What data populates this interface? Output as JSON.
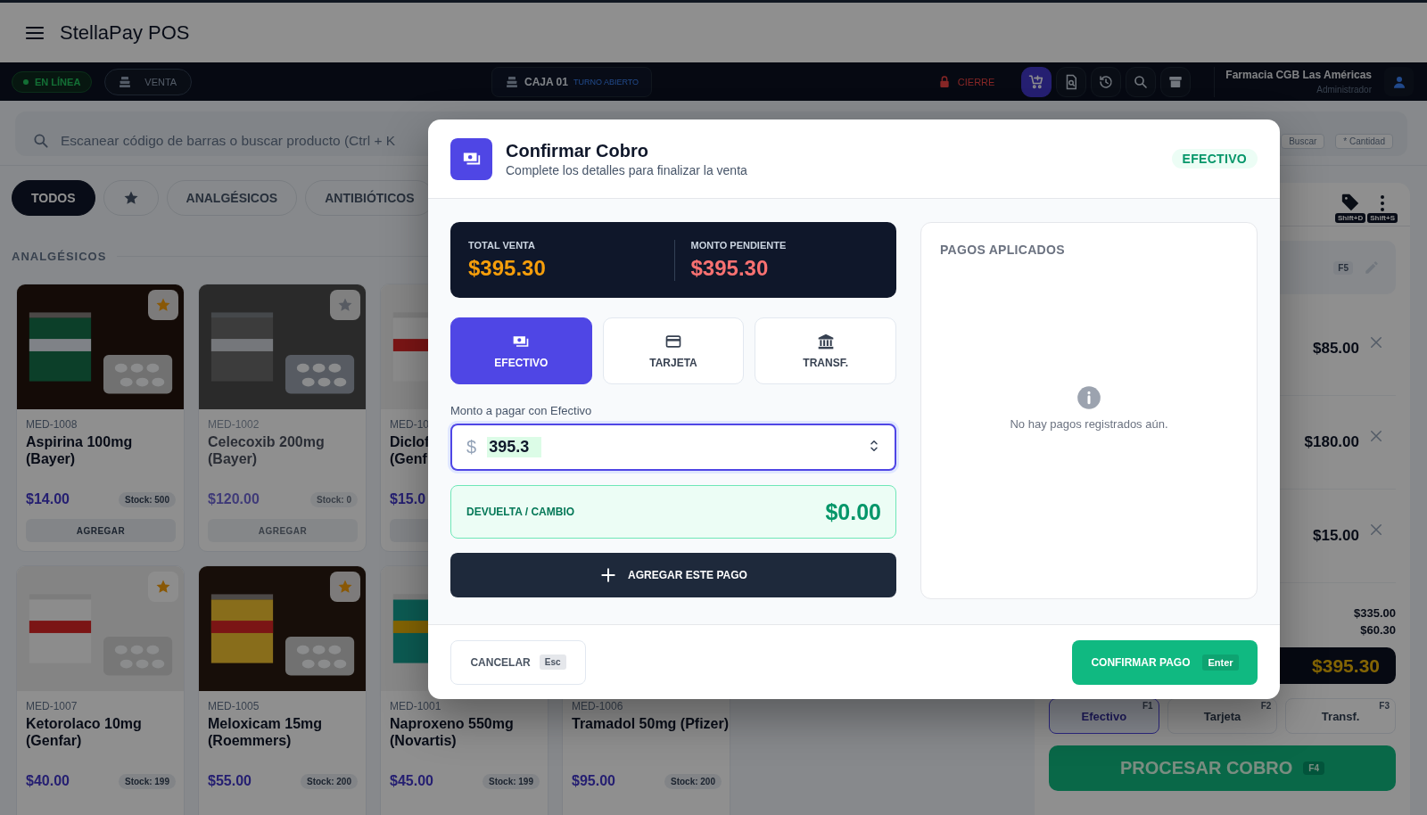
{
  "app": {
    "title": "StellaPay POS"
  },
  "nav": {
    "status": {
      "label": "EN LÍNEA",
      "online": true
    },
    "mode": {
      "label": "VENTA"
    },
    "register": {
      "name": "CAJA 01",
      "shift": "TURNO ABIERTO"
    },
    "close": {
      "label": "CIERRE"
    },
    "tools": [
      {
        "kind": "cart",
        "selected": true
      },
      {
        "kind": "preview",
        "selected": false
      },
      {
        "kind": "history",
        "selected": false
      },
      {
        "kind": "search",
        "selected": false
      },
      {
        "kind": "archive",
        "selected": false
      }
    ],
    "user": {
      "store": "Farmacia CGB Las Américas",
      "role": "Administrador"
    }
  },
  "search": {
    "placeholder": "Escanear código de barras o buscar producto (Ctrl + K",
    "hints": [
      "Buscar",
      "* Cantidad"
    ]
  },
  "categories": [
    {
      "kind": "text",
      "label": "TODOS",
      "selected": true
    },
    {
      "kind": "favorites",
      "selected": false
    },
    {
      "kind": "text",
      "label": "ANALGÉSICOS",
      "selected": false
    },
    {
      "kind": "text",
      "label": "ANTIBIÓTICOS",
      "selected": false
    }
  ],
  "section": {
    "title": "ANALGÉSICOS"
  },
  "product_rows": [
    [
      {
        "code": "MED-1008",
        "name_lines": [
          "Aspirina 100mg",
          "(Bayer)"
        ],
        "price": "$14.00",
        "stock": "Stock: 500",
        "button": "AGREGAR",
        "favorite": true,
        "disabled": false,
        "photo": true
      },
      {
        "code": "MED-1002",
        "name_lines": [
          "Celecoxib 200mg",
          "(Bayer)"
        ],
        "price": "$120.00",
        "stock": "Stock: 0",
        "button": "AGREGAR",
        "favorite": false,
        "disabled": true,
        "photo": true
      },
      {
        "code": "MED-10",
        "name_lines": [
          "Diclof",
          "(Genf"
        ],
        "price": "$15.0",
        "disabled": false,
        "photo": true
      }
    ],
    [
      {
        "code": "MED-1007",
        "name_lines": [
          "Ketorolaco 10mg",
          "(Genfar)"
        ],
        "price": "$40.00",
        "stock": "Stock: 199",
        "favorite": true,
        "disabled": false,
        "photo": true
      },
      {
        "code": "MED-1005",
        "name_lines": [
          "Meloxicam 15mg",
          "(Roemmers)"
        ],
        "price": "$55.00",
        "stock": "Stock: 200",
        "favorite": true,
        "disabled": false,
        "photo": true
      },
      {
        "code": "MED-1001",
        "name_lines": [
          "Naproxeno 550mg",
          "(Novartis)"
        ],
        "price": "$45.00",
        "stock": "Stock: 199",
        "disabled": false,
        "photo": true
      },
      {
        "code": "MED-1006",
        "name_lines": [
          "Tramadol 50mg (Pfizer)"
        ],
        "price": "$95.00",
        "stock": "Stock: 200",
        "disabled": false
      }
    ]
  ],
  "cart": {
    "actions": [
      {
        "kind": "tag",
        "shortcut": "Shift+D"
      },
      {
        "kind": "more",
        "shortcut": "Shift+S"
      }
    ],
    "customer": {
      "shortcut": "F5"
    },
    "items": [
      {
        "total": "$85.00"
      },
      {
        "total": "$180.00"
      },
      {
        "total": "$15.00"
      }
    ],
    "summary": [
      "$335.00",
      "$60.30"
    ],
    "total": "$395.30",
    "methods": [
      {
        "label": "Efectivo",
        "shortcut": "F1",
        "selected": true
      },
      {
        "label": "Tarjeta",
        "shortcut": "F2",
        "selected": false
      },
      {
        "label": "Transf.",
        "shortcut": "F3",
        "selected": false
      }
    ],
    "process": {
      "label": "PROCESAR COBRO",
      "shortcut": "F4"
    }
  },
  "modal": {
    "title": "Confirmar Cobro",
    "subtitle": "Complete los detalles para finalizar la venta",
    "badge": "EFECTIVO",
    "summary": [
      {
        "kind": "total",
        "label": "TOTAL VENTA",
        "amount": "$395.30"
      },
      {
        "kind": "pending",
        "label": "MONTO PENDIENTE",
        "amount": "$395.30"
      }
    ],
    "methods": [
      {
        "kind": "cash",
        "label": "EFECTIVO",
        "selected": true
      },
      {
        "kind": "card",
        "label": "TARJETA",
        "selected": false
      },
      {
        "kind": "bank",
        "label": "TRANSF.",
        "selected": false
      }
    ],
    "amount": {
      "label": "Monto a pagar con Efectivo",
      "prefix": "$",
      "value": "395.3"
    },
    "change": {
      "label": "DEVUELTA / CAMBIO",
      "amount": "$0.00"
    },
    "add_button": {
      "label": "AGREGAR ESTE PAGO"
    },
    "payments": {
      "title": "PAGOS APLICADOS",
      "empty": "No hay pagos registrados aún."
    },
    "cancel": {
      "label": "CANCELAR",
      "shortcut": "Esc"
    },
    "confirm": {
      "label": "CONFIRMAR PAGO",
      "shortcut": "Enter"
    }
  }
}
